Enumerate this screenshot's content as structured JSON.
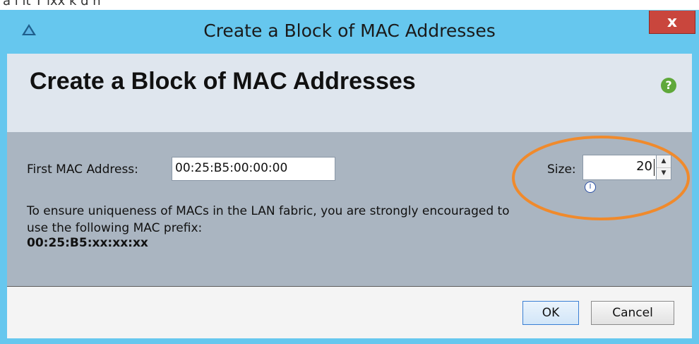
{
  "top_strip_text": "a  i   lt      T   lxx   k    d  n",
  "window": {
    "title": "Create a Block of MAC Addresses",
    "close_label": "x"
  },
  "header": {
    "title": "Create a Block of MAC Addresses",
    "help_label": "?"
  },
  "form": {
    "first_mac_label": "First MAC Address:",
    "first_mac_value": "00:25:B5:00:00:00",
    "size_label": "Size:",
    "size_value": "20",
    "hint_text": "To ensure uniqueness of MACs in the LAN fabric, you are strongly encouraged to use the following MAC prefix:",
    "prefix_value": "00:25:B5:xx:xx:xx"
  },
  "footer": {
    "ok_label": "OK",
    "cancel_label": "Cancel"
  },
  "colors": {
    "window_frame": "#66c7ee",
    "header_bg": "#dfe6ee",
    "form_bg": "#aab5c1",
    "close_button": "#c9463d",
    "highlight_ellipse": "#f08a2c",
    "help_icon": "#5fa83a"
  },
  "icons": {
    "app": "app-logo-icon",
    "help": "help-icon",
    "spin_up": "chevron-up-icon",
    "spin_down": "chevron-down-icon",
    "cursor": "text-cursor-icon"
  }
}
